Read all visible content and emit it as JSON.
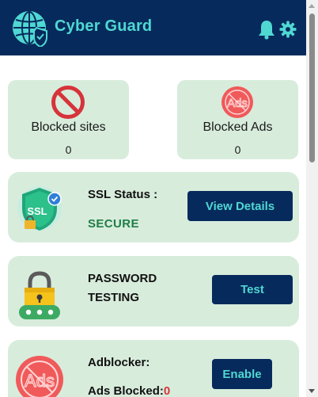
{
  "header": {
    "title": "Cyber Guard",
    "logo_icon": "globe-shield-icon",
    "notifications_icon": "bell-icon",
    "settings_icon": "gear-icon"
  },
  "stats": [
    {
      "icon": "blocked-icon",
      "label": "Blocked sites",
      "value": "0"
    },
    {
      "icon": "ads-blocked-icon",
      "label": "Blocked Ads",
      "value": "0"
    }
  ],
  "ssl": {
    "icon": "ssl-shield-icon",
    "title": "SSL Status :",
    "status": "SECURE",
    "button_label": "View Details"
  },
  "password": {
    "icon": "padlock-icon",
    "title_line1": "PASSWORD",
    "title_line2": "TESTING",
    "button_label": "Test"
  },
  "adblocker": {
    "icon": "ads-blocked-icon",
    "title": "Adblocker:",
    "count_label": "Ads Blocked:",
    "count_value": "0",
    "button_label": "Enable"
  },
  "colors": {
    "header_bg": "#072a5c",
    "accent": "#4fd8d2",
    "card_bg": "#d8ecdc",
    "secure_green": "#1e7e46",
    "blocked_red": "#d6343a"
  }
}
